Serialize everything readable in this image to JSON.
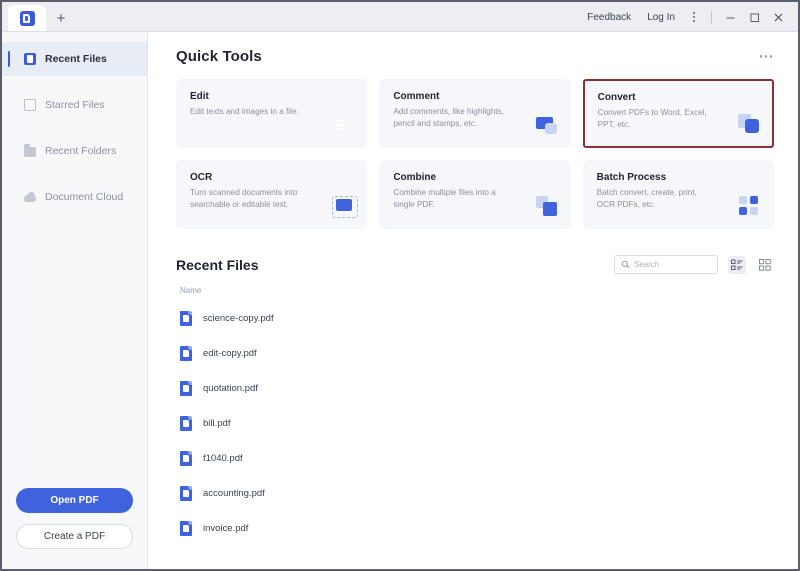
{
  "window": {
    "tab_logo": "pdf-app-logo",
    "new_tab_label": "+",
    "feedback_label": "Feedback",
    "login_label": "Log In",
    "menu_icon": "kebab-menu-icon",
    "minimize_icon": "minimize-icon",
    "maximize_icon": "maximize-icon",
    "close_icon": "close-icon"
  },
  "sidebar": {
    "items": [
      {
        "label": "Recent Files",
        "icon": "recent-files-icon",
        "active": true
      },
      {
        "label": "Starred Files",
        "icon": "starred-files-icon",
        "active": false
      },
      {
        "label": "Recent Folders",
        "icon": "recent-folders-icon",
        "active": false
      },
      {
        "label": "Document Cloud",
        "icon": "document-cloud-icon",
        "active": false
      }
    ],
    "open_pdf_label": "Open PDF",
    "create_pdf_label": "Create a PDF"
  },
  "quick_tools": {
    "title": "Quick Tools",
    "more_icon": "more-options-icon",
    "cards": [
      {
        "title": "Edit",
        "desc": "Edit texts and images in a file.",
        "icon": "edit-icon",
        "highlighted": false
      },
      {
        "title": "Comment",
        "desc": "Add comments, like highlights, pencil and stamps, etc.",
        "icon": "comment-icon",
        "highlighted": false
      },
      {
        "title": "Convert",
        "desc": "Convert PDFs to Word, Excel, PPT, etc.",
        "icon": "convert-icon",
        "highlighted": true,
        "highlight_color": "#8e2f33"
      },
      {
        "title": "OCR",
        "desc": "Turn scanned documents into searchable or editable text.",
        "icon": "ocr-icon",
        "highlighted": false
      },
      {
        "title": "Combine",
        "desc": "Combine multiple files into a single PDF.",
        "icon": "combine-icon",
        "highlighted": false
      },
      {
        "title": "Batch Process",
        "desc": "Batch convert, create, print, OCR PDFs, etc.",
        "icon": "batch-process-icon",
        "highlighted": false
      }
    ]
  },
  "recent_files": {
    "title": "Recent Files",
    "search_placeholder": "Search",
    "search_value": "",
    "search_icon": "search-icon",
    "list_view_icon": "list-view-icon",
    "grid_view_icon": "grid-view-icon",
    "column_name": "Name",
    "files": [
      {
        "name": "science-copy.pdf"
      },
      {
        "name": "edit-copy.pdf"
      },
      {
        "name": "quotation.pdf"
      },
      {
        "name": "bill.pdf"
      },
      {
        "name": "f1040.pdf"
      },
      {
        "name": "accounting.pdf"
      },
      {
        "name": "invoice.pdf"
      }
    ]
  },
  "colors": {
    "accent": "#3f63dd",
    "highlight": "#8e2f33",
    "sidebar_bg": "#f7f8fa",
    "card_bg": "#f6f7fa"
  }
}
